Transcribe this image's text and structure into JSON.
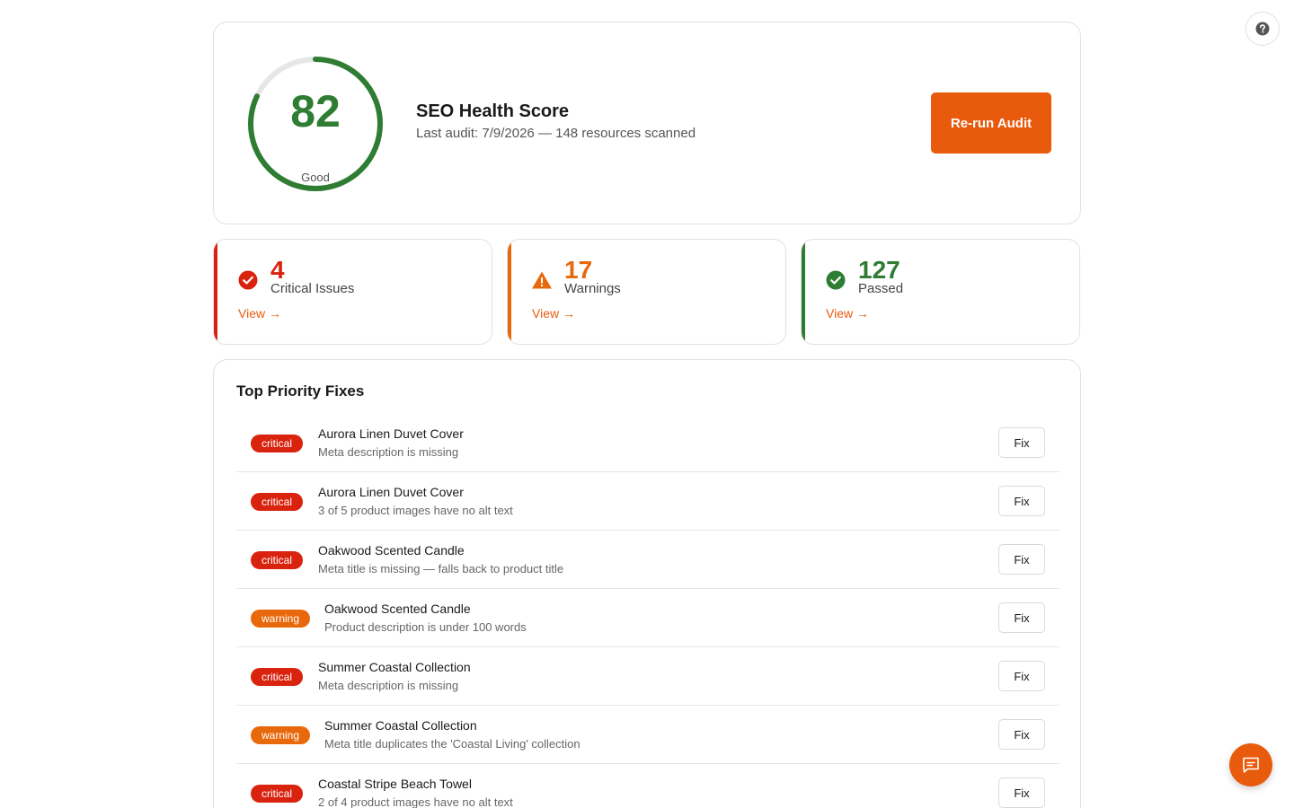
{
  "score": {
    "value": "82",
    "rating": "Good",
    "fraction": 0.82,
    "title": "SEO Health Score",
    "subtitle": "Last audit: 7/9/2026 — 148 resources scanned",
    "rerun_label": "Re-run Audit"
  },
  "stats": [
    {
      "count": "4",
      "label": "Critical Issues",
      "link": "View →",
      "color": "#d9230f",
      "icon": "check-circle-icon"
    },
    {
      "count": "17",
      "label": "Warnings",
      "link": "View →",
      "color": "#e8690c",
      "icon": "warning-triangle-icon"
    },
    {
      "count": "127",
      "label": "Passed",
      "link": "View →",
      "color": "#2e7d32",
      "icon": "check-circle-icon"
    }
  ],
  "fixes": {
    "title": "Top Priority Fixes",
    "items": [
      {
        "severity": "critical",
        "name": "Aurora Linen Duvet Cover",
        "issue": "Meta description is missing",
        "action": "Fix"
      },
      {
        "severity": "critical",
        "name": "Aurora Linen Duvet Cover",
        "issue": "3 of 5 product images have no alt text",
        "action": "Fix"
      },
      {
        "severity": "critical",
        "name": "Oakwood Scented Candle",
        "issue": "Meta title is missing — falls back to product title",
        "action": "Fix"
      },
      {
        "severity": "warning",
        "name": "Oakwood Scented Candle",
        "issue": "Product description is under 100 words",
        "action": "Fix"
      },
      {
        "severity": "critical",
        "name": "Summer Coastal Collection",
        "issue": "Meta description is missing",
        "action": "Fix"
      },
      {
        "severity": "warning",
        "name": "Summer Coastal Collection",
        "issue": "Meta title duplicates the 'Coastal Living' collection",
        "action": "Fix"
      },
      {
        "severity": "critical",
        "name": "Coastal Stripe Beach Towel",
        "issue": "2 of 4 product images have no alt text",
        "action": "Fix"
      }
    ]
  },
  "colors": {
    "accent": "#e85a0c",
    "critical": "#d9230f",
    "warning": "#e8690c",
    "good": "#2e7d32"
  },
  "icons": {
    "help": "help-circle-icon",
    "chat": "chat-icon"
  }
}
